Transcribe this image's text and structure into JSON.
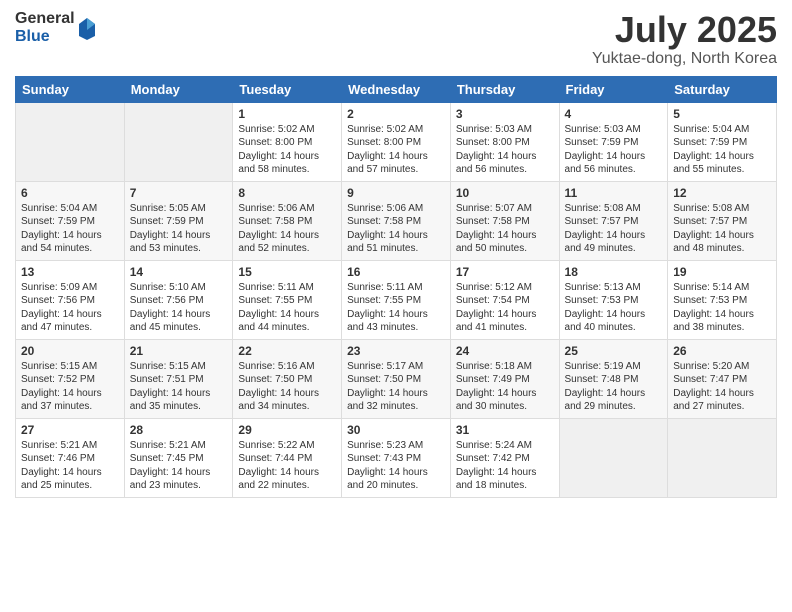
{
  "logo": {
    "general": "General",
    "blue": "Blue"
  },
  "header": {
    "month": "July 2025",
    "location": "Yuktae-dong, North Korea"
  },
  "weekdays": [
    "Sunday",
    "Monday",
    "Tuesday",
    "Wednesday",
    "Thursday",
    "Friday",
    "Saturday"
  ],
  "weeks": [
    [
      {
        "day": "",
        "sunrise": "",
        "sunset": "",
        "daylight": ""
      },
      {
        "day": "",
        "sunrise": "",
        "sunset": "",
        "daylight": ""
      },
      {
        "day": "1",
        "sunrise": "Sunrise: 5:02 AM",
        "sunset": "Sunset: 8:00 PM",
        "daylight": "Daylight: 14 hours and 58 minutes."
      },
      {
        "day": "2",
        "sunrise": "Sunrise: 5:02 AM",
        "sunset": "Sunset: 8:00 PM",
        "daylight": "Daylight: 14 hours and 57 minutes."
      },
      {
        "day": "3",
        "sunrise": "Sunrise: 5:03 AM",
        "sunset": "Sunset: 8:00 PM",
        "daylight": "Daylight: 14 hours and 56 minutes."
      },
      {
        "day": "4",
        "sunrise": "Sunrise: 5:03 AM",
        "sunset": "Sunset: 7:59 PM",
        "daylight": "Daylight: 14 hours and 56 minutes."
      },
      {
        "day": "5",
        "sunrise": "Sunrise: 5:04 AM",
        "sunset": "Sunset: 7:59 PM",
        "daylight": "Daylight: 14 hours and 55 minutes."
      }
    ],
    [
      {
        "day": "6",
        "sunrise": "Sunrise: 5:04 AM",
        "sunset": "Sunset: 7:59 PM",
        "daylight": "Daylight: 14 hours and 54 minutes."
      },
      {
        "day": "7",
        "sunrise": "Sunrise: 5:05 AM",
        "sunset": "Sunset: 7:59 PM",
        "daylight": "Daylight: 14 hours and 53 minutes."
      },
      {
        "day": "8",
        "sunrise": "Sunrise: 5:06 AM",
        "sunset": "Sunset: 7:58 PM",
        "daylight": "Daylight: 14 hours and 52 minutes."
      },
      {
        "day": "9",
        "sunrise": "Sunrise: 5:06 AM",
        "sunset": "Sunset: 7:58 PM",
        "daylight": "Daylight: 14 hours and 51 minutes."
      },
      {
        "day": "10",
        "sunrise": "Sunrise: 5:07 AM",
        "sunset": "Sunset: 7:58 PM",
        "daylight": "Daylight: 14 hours and 50 minutes."
      },
      {
        "day": "11",
        "sunrise": "Sunrise: 5:08 AM",
        "sunset": "Sunset: 7:57 PM",
        "daylight": "Daylight: 14 hours and 49 minutes."
      },
      {
        "day": "12",
        "sunrise": "Sunrise: 5:08 AM",
        "sunset": "Sunset: 7:57 PM",
        "daylight": "Daylight: 14 hours and 48 minutes."
      }
    ],
    [
      {
        "day": "13",
        "sunrise": "Sunrise: 5:09 AM",
        "sunset": "Sunset: 7:56 PM",
        "daylight": "Daylight: 14 hours and 47 minutes."
      },
      {
        "day": "14",
        "sunrise": "Sunrise: 5:10 AM",
        "sunset": "Sunset: 7:56 PM",
        "daylight": "Daylight: 14 hours and 45 minutes."
      },
      {
        "day": "15",
        "sunrise": "Sunrise: 5:11 AM",
        "sunset": "Sunset: 7:55 PM",
        "daylight": "Daylight: 14 hours and 44 minutes."
      },
      {
        "day": "16",
        "sunrise": "Sunrise: 5:11 AM",
        "sunset": "Sunset: 7:55 PM",
        "daylight": "Daylight: 14 hours and 43 minutes."
      },
      {
        "day": "17",
        "sunrise": "Sunrise: 5:12 AM",
        "sunset": "Sunset: 7:54 PM",
        "daylight": "Daylight: 14 hours and 41 minutes."
      },
      {
        "day": "18",
        "sunrise": "Sunrise: 5:13 AM",
        "sunset": "Sunset: 7:53 PM",
        "daylight": "Daylight: 14 hours and 40 minutes."
      },
      {
        "day": "19",
        "sunrise": "Sunrise: 5:14 AM",
        "sunset": "Sunset: 7:53 PM",
        "daylight": "Daylight: 14 hours and 38 minutes."
      }
    ],
    [
      {
        "day": "20",
        "sunrise": "Sunrise: 5:15 AM",
        "sunset": "Sunset: 7:52 PM",
        "daylight": "Daylight: 14 hours and 37 minutes."
      },
      {
        "day": "21",
        "sunrise": "Sunrise: 5:15 AM",
        "sunset": "Sunset: 7:51 PM",
        "daylight": "Daylight: 14 hours and 35 minutes."
      },
      {
        "day": "22",
        "sunrise": "Sunrise: 5:16 AM",
        "sunset": "Sunset: 7:50 PM",
        "daylight": "Daylight: 14 hours and 34 minutes."
      },
      {
        "day": "23",
        "sunrise": "Sunrise: 5:17 AM",
        "sunset": "Sunset: 7:50 PM",
        "daylight": "Daylight: 14 hours and 32 minutes."
      },
      {
        "day": "24",
        "sunrise": "Sunrise: 5:18 AM",
        "sunset": "Sunset: 7:49 PM",
        "daylight": "Daylight: 14 hours and 30 minutes."
      },
      {
        "day": "25",
        "sunrise": "Sunrise: 5:19 AM",
        "sunset": "Sunset: 7:48 PM",
        "daylight": "Daylight: 14 hours and 29 minutes."
      },
      {
        "day": "26",
        "sunrise": "Sunrise: 5:20 AM",
        "sunset": "Sunset: 7:47 PM",
        "daylight": "Daylight: 14 hours and 27 minutes."
      }
    ],
    [
      {
        "day": "27",
        "sunrise": "Sunrise: 5:21 AM",
        "sunset": "Sunset: 7:46 PM",
        "daylight": "Daylight: 14 hours and 25 minutes."
      },
      {
        "day": "28",
        "sunrise": "Sunrise: 5:21 AM",
        "sunset": "Sunset: 7:45 PM",
        "daylight": "Daylight: 14 hours and 23 minutes."
      },
      {
        "day": "29",
        "sunrise": "Sunrise: 5:22 AM",
        "sunset": "Sunset: 7:44 PM",
        "daylight": "Daylight: 14 hours and 22 minutes."
      },
      {
        "day": "30",
        "sunrise": "Sunrise: 5:23 AM",
        "sunset": "Sunset: 7:43 PM",
        "daylight": "Daylight: 14 hours and 20 minutes."
      },
      {
        "day": "31",
        "sunrise": "Sunrise: 5:24 AM",
        "sunset": "Sunset: 7:42 PM",
        "daylight": "Daylight: 14 hours and 18 minutes."
      },
      {
        "day": "",
        "sunrise": "",
        "sunset": "",
        "daylight": ""
      },
      {
        "day": "",
        "sunrise": "",
        "sunset": "",
        "daylight": ""
      }
    ]
  ]
}
